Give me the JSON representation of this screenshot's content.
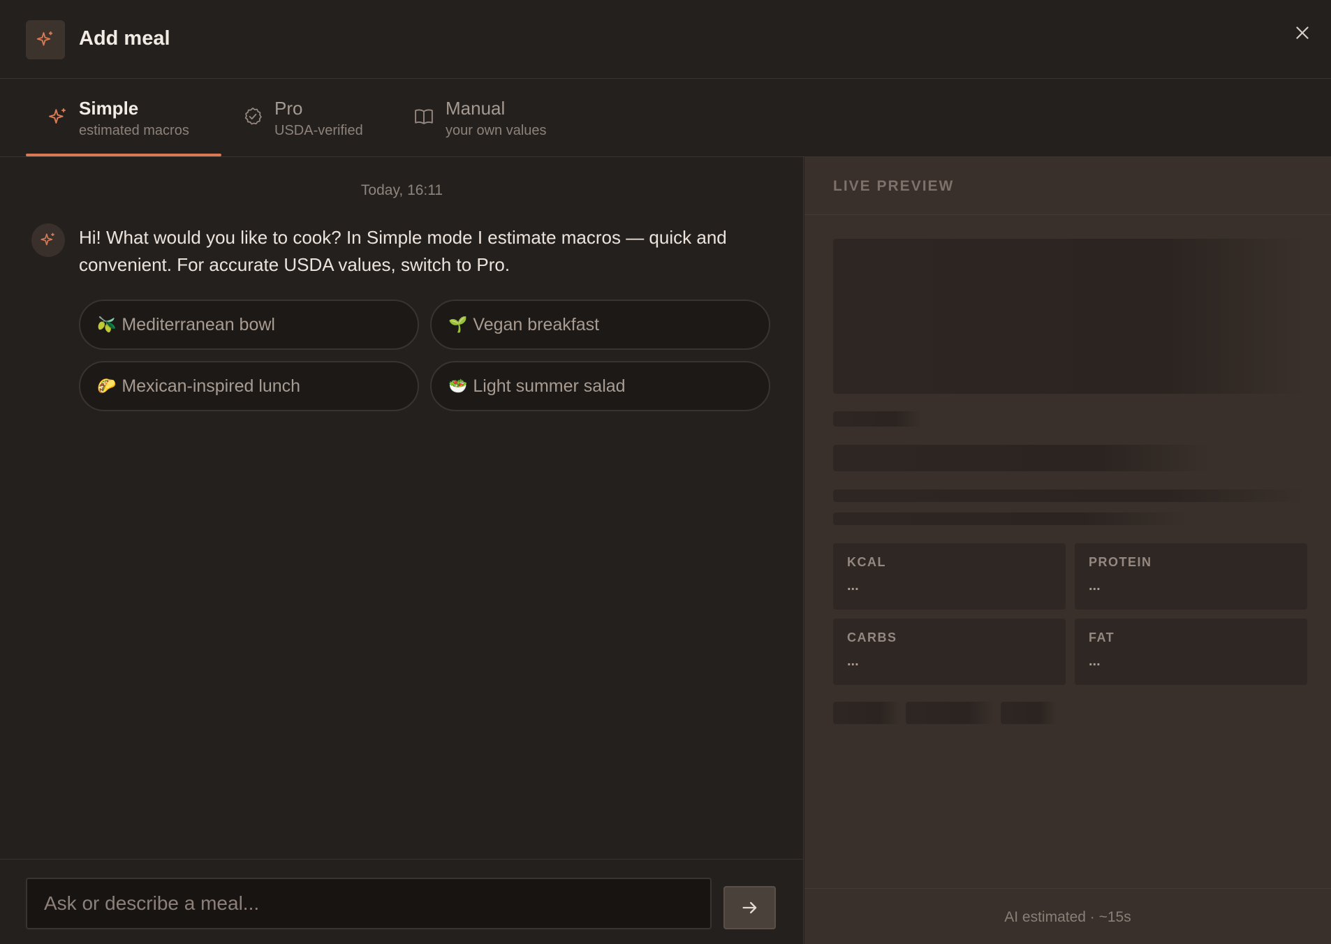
{
  "header": {
    "title": "Add meal",
    "logo_icon": "sparkle-icon",
    "close_icon": "close-icon"
  },
  "tabs": [
    {
      "label": "Simple",
      "sub": "estimated macros",
      "icon": "sparkle-icon",
      "active": true
    },
    {
      "label": "Pro",
      "sub": "USDA-verified",
      "icon": "check-circle-icon",
      "active": false
    },
    {
      "label": "Manual",
      "sub": "your own values",
      "icon": "book-icon",
      "active": false
    }
  ],
  "chat": {
    "timestamp": "Today, 16:11",
    "bot_message": "Hi! What would you like to cook? In Simple mode I estimate macros — quick and convenient. For accurate USDA values, switch to Pro.",
    "suggestions": [
      {
        "emoji": "🫒",
        "label": "Mediterranean bowl"
      },
      {
        "emoji": "🌱",
        "label": "Vegan breakfast"
      },
      {
        "emoji": "🌮",
        "label": "Mexican-inspired lunch"
      },
      {
        "emoji": "🥗",
        "label": "Light summer salad"
      }
    ]
  },
  "composer": {
    "placeholder": "Ask or describe a meal...",
    "send_icon": "arrow-right-icon"
  },
  "preview": {
    "title": "LIVE PREVIEW",
    "macros": [
      {
        "label": "KCAL",
        "value": "..."
      },
      {
        "label": "PROTEIN",
        "value": "..."
      },
      {
        "label": "CARBS",
        "value": "..."
      },
      {
        "label": "FAT",
        "value": "..."
      }
    ],
    "footer": "AI estimated · ~15s"
  },
  "colors": {
    "accent": "#d97a55",
    "background": "#24201d",
    "preview_background": "#3a302b"
  }
}
